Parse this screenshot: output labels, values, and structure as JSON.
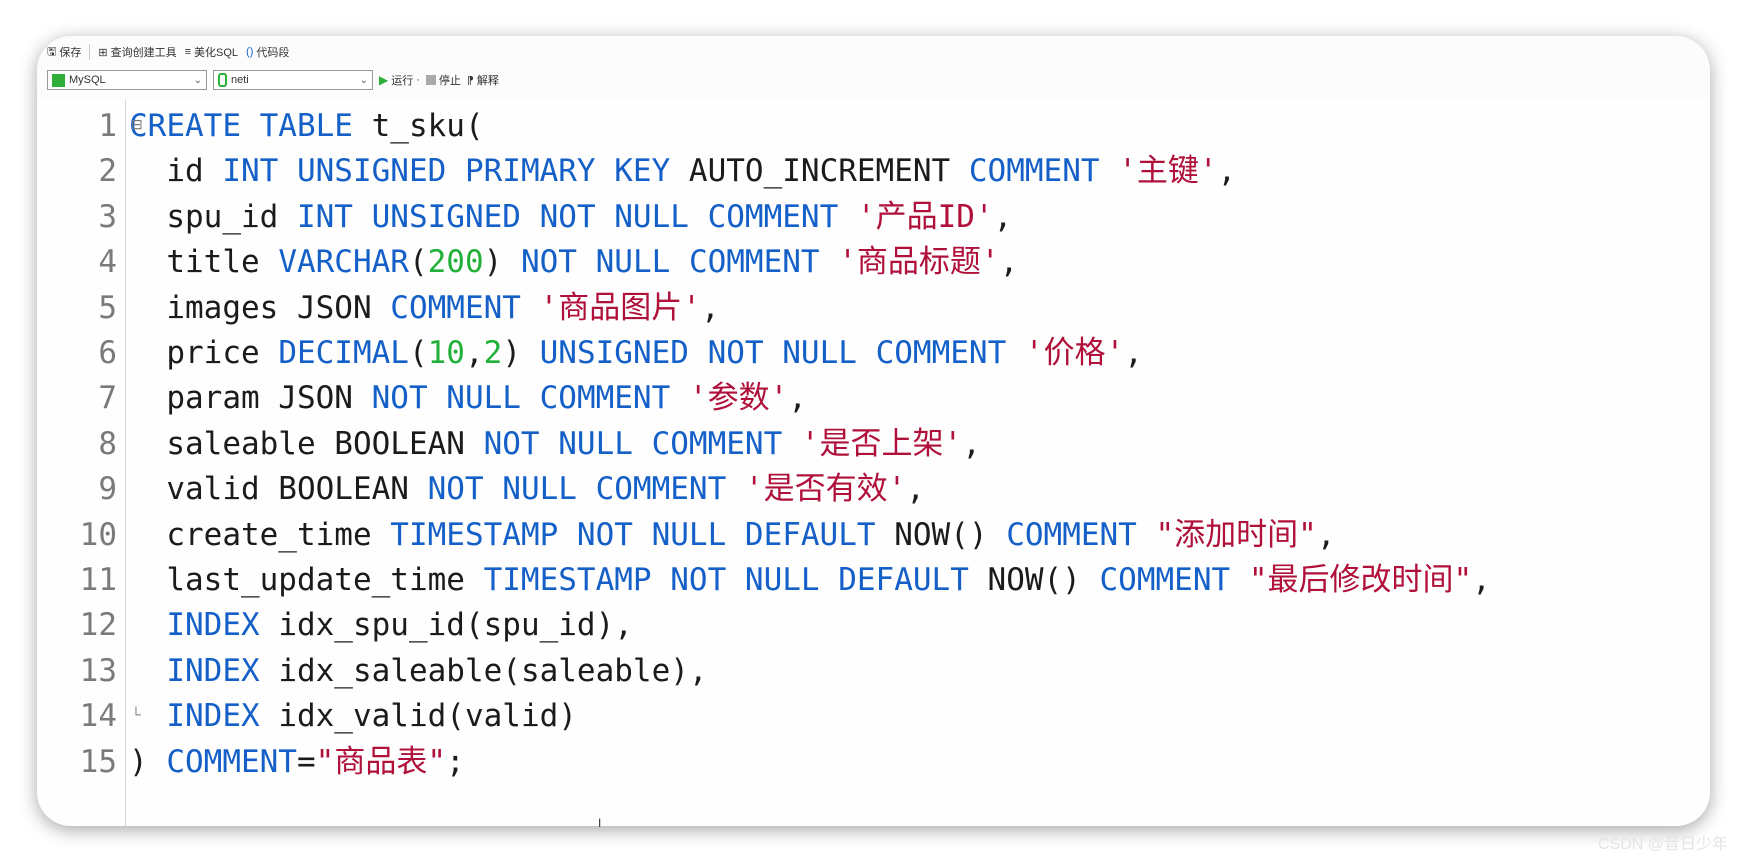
{
  "toolbar": {
    "row1": [
      "保存",
      "查询创建工具",
      "美化SQL",
      "代码段"
    ],
    "connection": "MySQL",
    "database": "neti",
    "run_label": "运行",
    "stop_label": "停止",
    "explain_label": "解释"
  },
  "colors": {
    "keyword": "#1560c8",
    "string": "#b0103a",
    "number": "#23b03a",
    "identifier": "#1b1b1b"
  },
  "editor": {
    "lines": [
      {
        "num": "1",
        "tokens": [
          {
            "t": "CREATE TABLE ",
            "c": "kw"
          },
          {
            "t": "t_sku(",
            "c": "id"
          }
        ]
      },
      {
        "num": "2",
        "tokens": [
          {
            "t": "  id ",
            "c": "id"
          },
          {
            "t": "INT UNSIGNED PRIMARY KEY ",
            "c": "kw"
          },
          {
            "t": "AUTO_INCREMENT ",
            "c": "id"
          },
          {
            "t": "COMMENT ",
            "c": "kw"
          },
          {
            "t": "'主键'",
            "c": "str"
          },
          {
            "t": ",",
            "c": "id"
          }
        ]
      },
      {
        "num": "3",
        "tokens": [
          {
            "t": "  spu_id ",
            "c": "id"
          },
          {
            "t": "INT UNSIGNED NOT NULL COMMENT ",
            "c": "kw"
          },
          {
            "t": "'产品ID'",
            "c": "str"
          },
          {
            "t": ",",
            "c": "id"
          }
        ]
      },
      {
        "num": "4",
        "tokens": [
          {
            "t": "  title ",
            "c": "id"
          },
          {
            "t": "VARCHAR",
            "c": "kw"
          },
          {
            "t": "(",
            "c": "id"
          },
          {
            "t": "200",
            "c": "num"
          },
          {
            "t": ") ",
            "c": "id"
          },
          {
            "t": "NOT NULL COMMENT ",
            "c": "kw"
          },
          {
            "t": "'商品标题'",
            "c": "str"
          },
          {
            "t": ",",
            "c": "id"
          }
        ]
      },
      {
        "num": "5",
        "tokens": [
          {
            "t": "  images JSON ",
            "c": "id"
          },
          {
            "t": "COMMENT ",
            "c": "kw"
          },
          {
            "t": "'商品图片'",
            "c": "str"
          },
          {
            "t": ",",
            "c": "id"
          }
        ]
      },
      {
        "num": "6",
        "tokens": [
          {
            "t": "  price ",
            "c": "id"
          },
          {
            "t": "DECIMAL",
            "c": "kw"
          },
          {
            "t": "(",
            "c": "id"
          },
          {
            "t": "10",
            "c": "num"
          },
          {
            "t": ",",
            "c": "id"
          },
          {
            "t": "2",
            "c": "num"
          },
          {
            "t": ") ",
            "c": "id"
          },
          {
            "t": "UNSIGNED NOT NULL COMMENT ",
            "c": "kw"
          },
          {
            "t": "'价格'",
            "c": "str"
          },
          {
            "t": ",",
            "c": "id"
          }
        ]
      },
      {
        "num": "7",
        "tokens": [
          {
            "t": "  param JSON ",
            "c": "id"
          },
          {
            "t": "NOT NULL COMMENT ",
            "c": "kw"
          },
          {
            "t": "'参数'",
            "c": "str"
          },
          {
            "t": ",",
            "c": "id"
          }
        ]
      },
      {
        "num": "8",
        "tokens": [
          {
            "t": "  saleable BOOLEAN ",
            "c": "id"
          },
          {
            "t": "NOT NULL COMMENT ",
            "c": "kw"
          },
          {
            "t": "'是否上架'",
            "c": "str"
          },
          {
            "t": ",",
            "c": "id"
          }
        ]
      },
      {
        "num": "9",
        "tokens": [
          {
            "t": "  valid BOOLEAN ",
            "c": "id"
          },
          {
            "t": "NOT NULL COMMENT ",
            "c": "kw"
          },
          {
            "t": "'是否有效'",
            "c": "str"
          },
          {
            "t": ",",
            "c": "id"
          }
        ]
      },
      {
        "num": "10",
        "tokens": [
          {
            "t": "  create_time ",
            "c": "id"
          },
          {
            "t": "TIMESTAMP NOT NULL DEFAULT ",
            "c": "kw"
          },
          {
            "t": "NOW() ",
            "c": "id"
          },
          {
            "t": "COMMENT ",
            "c": "kw"
          },
          {
            "t": "\"添加时间\"",
            "c": "str"
          },
          {
            "t": ",",
            "c": "id"
          }
        ]
      },
      {
        "num": "11",
        "tokens": [
          {
            "t": "  last_update_time ",
            "c": "id"
          },
          {
            "t": "TIMESTAMP NOT NULL DEFAULT ",
            "c": "kw"
          },
          {
            "t": "NOW() ",
            "c": "id"
          },
          {
            "t": "COMMENT ",
            "c": "kw"
          },
          {
            "t": "\"最后修改时间\"",
            "c": "str"
          },
          {
            "t": ",",
            "c": "id"
          }
        ]
      },
      {
        "num": "12",
        "tokens": [
          {
            "t": "  ",
            "c": "id"
          },
          {
            "t": "INDEX ",
            "c": "kw"
          },
          {
            "t": "idx_spu_id(spu_id),",
            "c": "id"
          }
        ]
      },
      {
        "num": "13",
        "tokens": [
          {
            "t": "  ",
            "c": "id"
          },
          {
            "t": "INDEX ",
            "c": "kw"
          },
          {
            "t": "idx_saleable(saleable),",
            "c": "id"
          }
        ]
      },
      {
        "num": "14",
        "tokens": [
          {
            "t": "  ",
            "c": "id"
          },
          {
            "t": "INDEX ",
            "c": "kw"
          },
          {
            "t": "idx_valid(valid)",
            "c": "id"
          }
        ]
      },
      {
        "num": "15",
        "tokens": [
          {
            "t": ") ",
            "c": "id"
          },
          {
            "t": "COMMENT",
            "c": "kw"
          },
          {
            "t": "=",
            "c": "id"
          },
          {
            "t": "\"商品表\"",
            "c": "str"
          },
          {
            "t": ";",
            "c": "id"
          }
        ]
      }
    ]
  },
  "watermark": "CSDN @昔日少年"
}
